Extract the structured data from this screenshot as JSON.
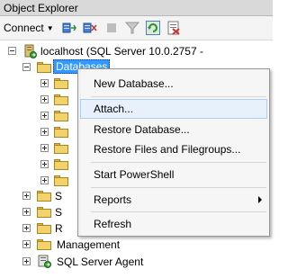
{
  "window": {
    "title": "Object Explorer"
  },
  "toolbar": {
    "connect_label": "Connect",
    "buttons": [
      "connect-icon",
      "disconnect-icon",
      "stop-icon",
      "filter-icon",
      "refresh-icon",
      "summary-icon"
    ]
  },
  "tree": {
    "server_label": "localhost (SQL Server 10.0.2757 -",
    "databases_label": "Databases",
    "partial_labels": [
      "S",
      "S",
      "R"
    ],
    "management_label": "Management",
    "agent_label": "SQL Server Agent"
  },
  "context_menu": {
    "items": [
      {
        "label": "New Database..."
      },
      {
        "label": "Attach..."
      },
      {
        "label": "Restore Database..."
      },
      {
        "label": "Restore Files and Filegroups..."
      },
      {
        "label": "Start PowerShell"
      },
      {
        "label": "Reports"
      },
      {
        "label": "Refresh"
      }
    ],
    "highlighted": "Attach..."
  },
  "colors": {
    "selection": "#3399ff",
    "folder": "#f2d36b",
    "menu_hover": "#e8f1fb"
  }
}
